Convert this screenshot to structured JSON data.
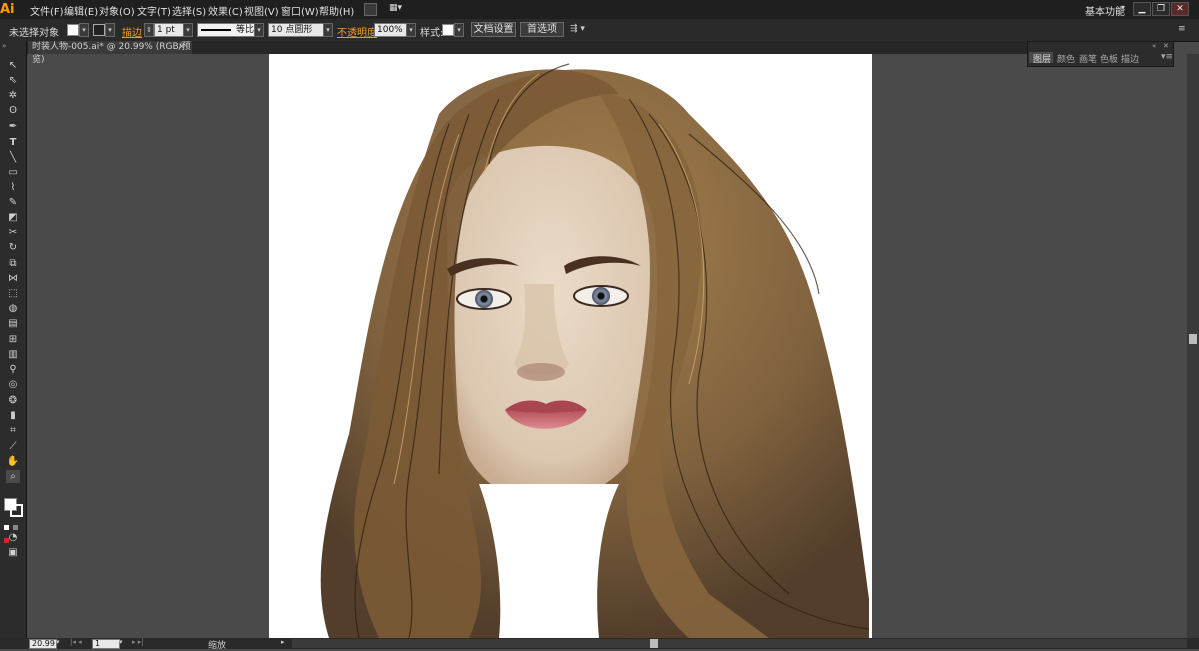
{
  "app": {
    "logo": "Ai",
    "workspace": "基本功能"
  },
  "menu": [
    "文件(F)",
    "编辑(E)",
    "对象(O)",
    "文字(T)",
    "选择(S)",
    "效果(C)",
    "视图(V)",
    "窗口(W)",
    "帮助(H)"
  ],
  "window_buttons": {
    "minimize": "▁",
    "restore": "❐",
    "close": "✕"
  },
  "control": {
    "selection_state": "未选择对象",
    "stroke_label": "描边",
    "stroke_weight": "1 pt",
    "stroke_profile": "等比",
    "brush": "10 点圆形",
    "opacity_label": "不透明度",
    "opacity": "100%",
    "style_label": "样式:",
    "doc_setup": "文档设置",
    "preferences": "首选项"
  },
  "document_tab": {
    "title": "时装人物-005.ai* @ 20.99% (RGB/预览)",
    "close": "×"
  },
  "panel": {
    "tabs": [
      "图层",
      "颜色",
      "画笔",
      "色板",
      "描边"
    ]
  },
  "status": {
    "zoom": "20.99",
    "page": "1",
    "info": "缩放"
  },
  "colors": {
    "accent": "#f39a1e",
    "hair": "#7a5a34",
    "skin": "#e3d3c0",
    "lips": "#c76b74"
  }
}
